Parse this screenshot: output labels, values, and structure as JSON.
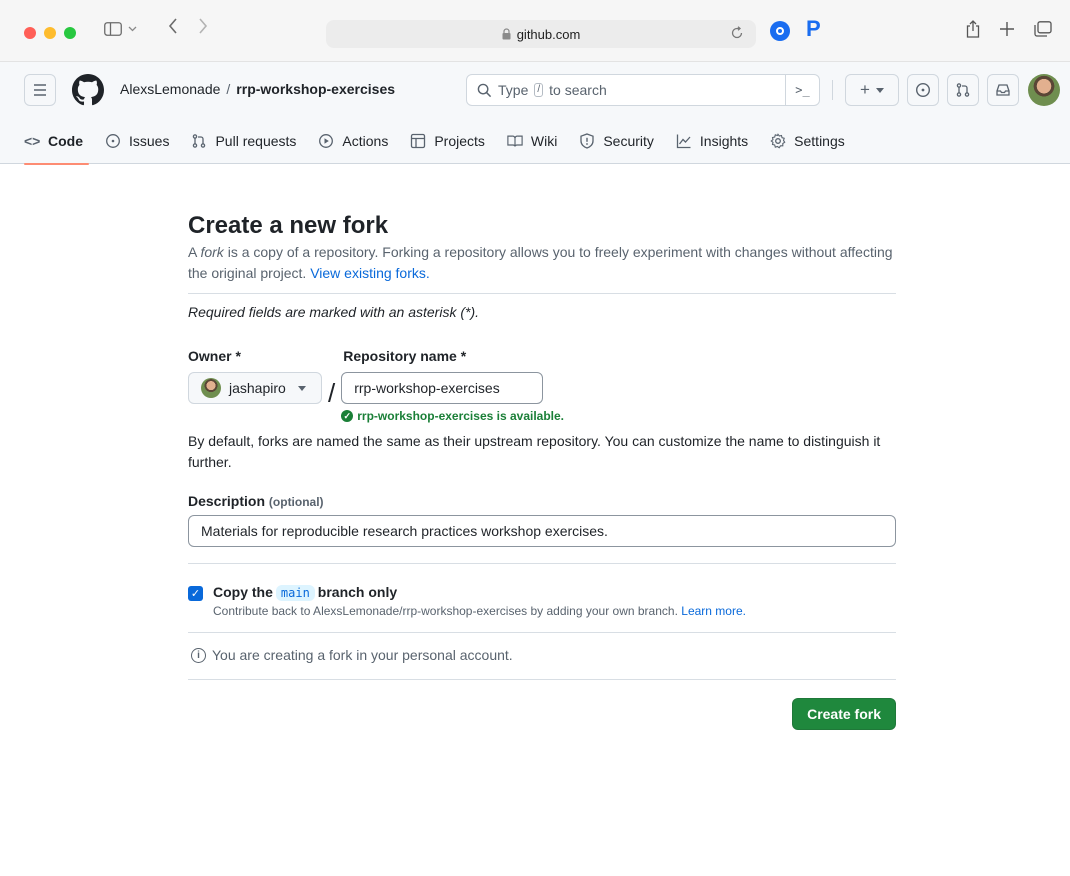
{
  "browser": {
    "address": "github.com"
  },
  "header": {
    "owner": "AlexsLemonade",
    "separator": "/",
    "repo": "rrp-workshop-exercises",
    "search_prefix": "Type",
    "search_key": "/",
    "search_suffix": "to search",
    "command_palette": ">_",
    "create_label": "+"
  },
  "tabs": [
    {
      "label": "Code",
      "icon": "code-icon"
    },
    {
      "label": "Issues",
      "icon": "issue-icon"
    },
    {
      "label": "Pull requests",
      "icon": "pull-request-icon"
    },
    {
      "label": "Actions",
      "icon": "play-icon"
    },
    {
      "label": "Projects",
      "icon": "table-icon"
    },
    {
      "label": "Wiki",
      "icon": "book-icon"
    },
    {
      "label": "Security",
      "icon": "shield-icon"
    },
    {
      "label": "Insights",
      "icon": "graph-icon"
    },
    {
      "label": "Settings",
      "icon": "gear-icon"
    }
  ],
  "form": {
    "title": "Create a new fork",
    "lead_prefix": "A",
    "lead_em": "fork",
    "lead_rest": "is a copy of a repository. Forking a repository allows you to freely experiment with changes without affecting the original project.",
    "lead_link": "View existing forks.",
    "required_note": "Required fields are marked with an asterisk (*).",
    "owner_label": "Owner *",
    "owner_value": "jashapiro",
    "slash": "/",
    "repo_label": "Repository name *",
    "repo_value": "rrp-workshop-exercises",
    "availability": "rrp-workshop-exercises is available.",
    "naming_note": "By default, forks are named the same as their upstream repository. You can customize the name to distinguish it further.",
    "description_label": "Description",
    "description_optional": "(optional)",
    "description_value": "Materials for reproducible research practices workshop exercises.",
    "copy_prefix": "Copy the",
    "copy_branch": "main",
    "copy_suffix": "branch only",
    "copy_sub": "Contribute back to AlexsLemonade/rrp-workshop-exercises by adding your own branch.",
    "copy_learn_more": "Learn more.",
    "copy_checked": true,
    "account_note": "You are creating a fork in your personal account.",
    "submit_label": "Create fork"
  },
  "colors": {
    "primary_button": "#1f883d",
    "link": "#0969da",
    "success": "#1a7f37",
    "active_tab_underline": "#fd8c73"
  }
}
